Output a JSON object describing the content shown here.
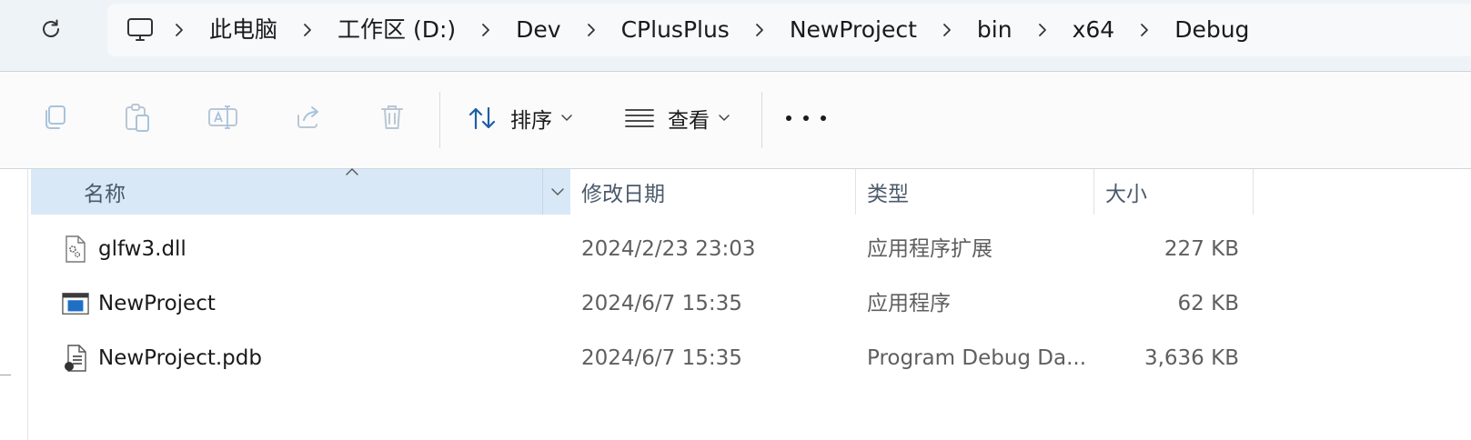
{
  "address_bar": {
    "refresh_icon": "refresh-icon",
    "computer_icon": "computer-icon",
    "crumbs": [
      "此电脑",
      "工作区 (D:)",
      "Dev",
      "CPlusPlus",
      "NewProject",
      "bin",
      "x64",
      "Debug"
    ]
  },
  "toolbar": {
    "copy_icon": "copy-icon",
    "paste_icon": "paste-icon",
    "rename_icon": "rename-icon",
    "share_icon": "share-icon",
    "delete_icon": "delete-icon",
    "sort_label": "排序",
    "view_label": "查看",
    "more_icon": "more-icon"
  },
  "columns": {
    "name": "名称",
    "modified": "修改日期",
    "type": "类型",
    "size": "大小"
  },
  "files": [
    {
      "name": "glfw3.dll",
      "modified": "2024/2/23 23:03",
      "type": "应用程序扩展",
      "size": "227 KB",
      "icon": "dll-file-icon"
    },
    {
      "name": "NewProject",
      "modified": "2024/6/7 15:35",
      "type": "应用程序",
      "size": "62 KB",
      "icon": "exe-file-icon"
    },
    {
      "name": "NewProject.pdb",
      "modified": "2024/6/7 15:35",
      "type": "Program Debug Da...",
      "size": "3,636 KB",
      "icon": "pdb-file-icon"
    }
  ],
  "colors": {
    "address_bg": "#eef3f8",
    "selected_header_bg": "#d8e8f6",
    "accent_blue": "#1f6fc5"
  }
}
